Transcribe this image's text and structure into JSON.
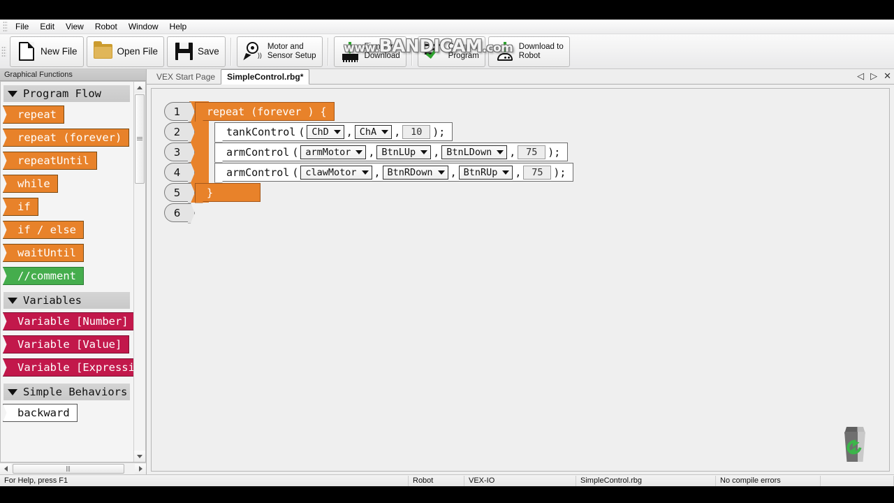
{
  "menu": {
    "items": [
      "File",
      "Edit",
      "View",
      "Robot",
      "Window",
      "Help"
    ]
  },
  "toolbar": {
    "new_file": "New File",
    "open_file": "Open File",
    "save": "Save",
    "motor_sensor_setup": "Motor and\nSensor Setup",
    "firmware_download": "Firmware\nDownload",
    "compile_program": "Compile\nProgram",
    "download_to_robot": "Download to\nRobot"
  },
  "watermark": {
    "prefix": "www.",
    "main": "BANDICAM",
    "suffix": ".com"
  },
  "sidebar": {
    "title": "Graphical Functions",
    "sections": [
      {
        "name": "Program Flow",
        "blocks": [
          {
            "label": "repeat",
            "color": "orange"
          },
          {
            "label": "repeat (forever)",
            "color": "orange"
          },
          {
            "label": "repeatUntil",
            "color": "orange"
          },
          {
            "label": "while",
            "color": "orange"
          },
          {
            "label": "if",
            "color": "orange"
          },
          {
            "label": "if / else",
            "color": "orange"
          },
          {
            "label": "waitUntil",
            "color": "orange"
          },
          {
            "label": "//comment",
            "color": "green"
          }
        ]
      },
      {
        "name": "Variables",
        "blocks": [
          {
            "label": "Variable [Number]",
            "color": "red"
          },
          {
            "label": "Variable [Value]",
            "color": "red"
          },
          {
            "label": "Variable [Expressi",
            "color": "red"
          }
        ]
      },
      {
        "name": "Simple Behaviors",
        "blocks": [
          {
            "label": "backward",
            "color": "white"
          }
        ]
      }
    ]
  },
  "tabs": {
    "items": [
      {
        "label": "VEX Start Page",
        "active": false
      },
      {
        "label": "SimpleControl.rbg*",
        "active": true
      }
    ],
    "controls": {
      "prev": "◁",
      "next": "▷",
      "close": "✕"
    }
  },
  "editor": {
    "lines": [
      {
        "number": "1",
        "kind": "orange",
        "text": "repeat (forever ) {"
      },
      {
        "number": "2",
        "kind": "stmt",
        "name": "tankControl",
        "open": "(",
        "args": [
          {
            "type": "dropdown",
            "value": "ChD"
          },
          {
            "type": "comma",
            "value": ","
          },
          {
            "type": "dropdown",
            "value": "ChA"
          },
          {
            "type": "comma",
            "value": ","
          },
          {
            "type": "number",
            "value": "10"
          }
        ],
        "close": ");"
      },
      {
        "number": "3",
        "kind": "stmt",
        "name": "armControl",
        "open": "(",
        "args": [
          {
            "type": "dropdown",
            "value": "armMotor"
          },
          {
            "type": "comma",
            "value": ","
          },
          {
            "type": "dropdown",
            "value": "BtnLUp"
          },
          {
            "type": "comma",
            "value": ","
          },
          {
            "type": "dropdown",
            "value": "BtnLDown"
          },
          {
            "type": "comma",
            "value": ","
          },
          {
            "type": "number",
            "value": "75"
          }
        ],
        "close": ");"
      },
      {
        "number": "4",
        "kind": "stmt",
        "name": "armControl",
        "open": "(",
        "args": [
          {
            "type": "dropdown",
            "value": "clawMotor"
          },
          {
            "type": "comma",
            "value": ","
          },
          {
            "type": "dropdown",
            "value": "BtnRDown"
          },
          {
            "type": "comma",
            "value": ","
          },
          {
            "type": "dropdown",
            "value": "BtnRUp"
          },
          {
            "type": "comma",
            "value": ","
          },
          {
            "type": "number",
            "value": "75"
          }
        ],
        "close": ");"
      },
      {
        "number": "5",
        "kind": "orange-close",
        "text": "}"
      },
      {
        "number": "6",
        "kind": "empty",
        "text": ""
      }
    ]
  },
  "status": {
    "help": "For Help, press F1",
    "robot": "Robot",
    "platform": "VEX-IO",
    "blank": "",
    "file": "SimpleControl.rbg",
    "compile": "No compile errors"
  },
  "colors": {
    "block_orange": "#e8822a",
    "block_green": "#45ad4d",
    "block_red": "#c2184b",
    "accent_green": "#2fa32f"
  },
  "icons": {
    "trash": "recycle-bin"
  }
}
